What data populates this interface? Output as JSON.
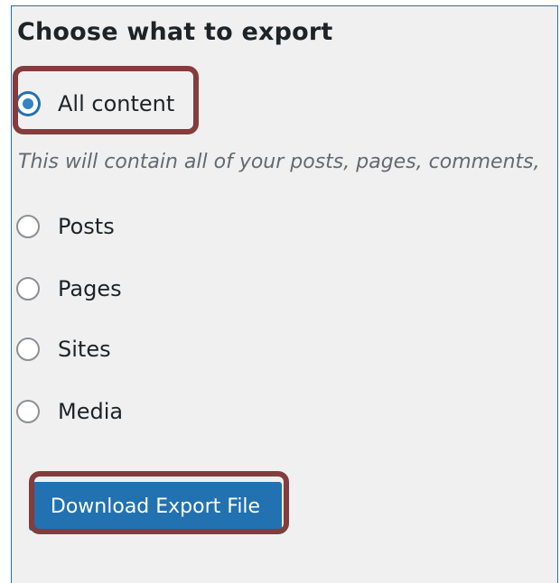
{
  "export": {
    "heading": "Choose what to export",
    "description": "This will contain all of your posts, pages, comments,",
    "options": [
      {
        "label": "All content",
        "checked": true
      },
      {
        "label": "Posts",
        "checked": false
      },
      {
        "label": "Pages",
        "checked": false
      },
      {
        "label": "Sites",
        "checked": false
      },
      {
        "label": "Media",
        "checked": false
      }
    ],
    "button_label": "Download Export File"
  },
  "colors": {
    "accent": "#2271b1",
    "panel_background": "#f0f0f1",
    "highlight_border": "#843c3c",
    "description_text": "#646970"
  }
}
